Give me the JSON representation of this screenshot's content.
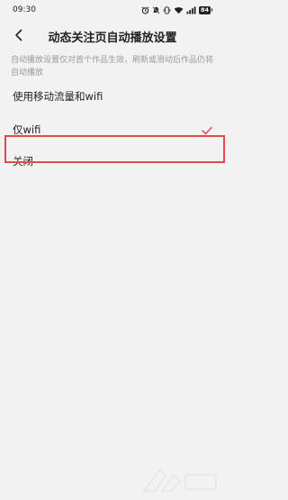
{
  "status_bar": {
    "time": "09:30",
    "battery": "84"
  },
  "header": {
    "back_icon": "chevron-left-icon",
    "title": "动态关注页自动播放设置"
  },
  "description": "自动播放设置仅对首个作品生效，刷新或滑动后作品仍将自动播放",
  "options": [
    {
      "label": "使用移动流量和wifi",
      "selected": false
    },
    {
      "label": "仅wifi",
      "selected": true
    },
    {
      "label": "关闭",
      "selected": false
    }
  ],
  "colors": {
    "accent": "#e64b5a",
    "highlight": "#e34a4a",
    "background": "#f2f2f2",
    "text": "#222222",
    "muted": "#999999"
  }
}
